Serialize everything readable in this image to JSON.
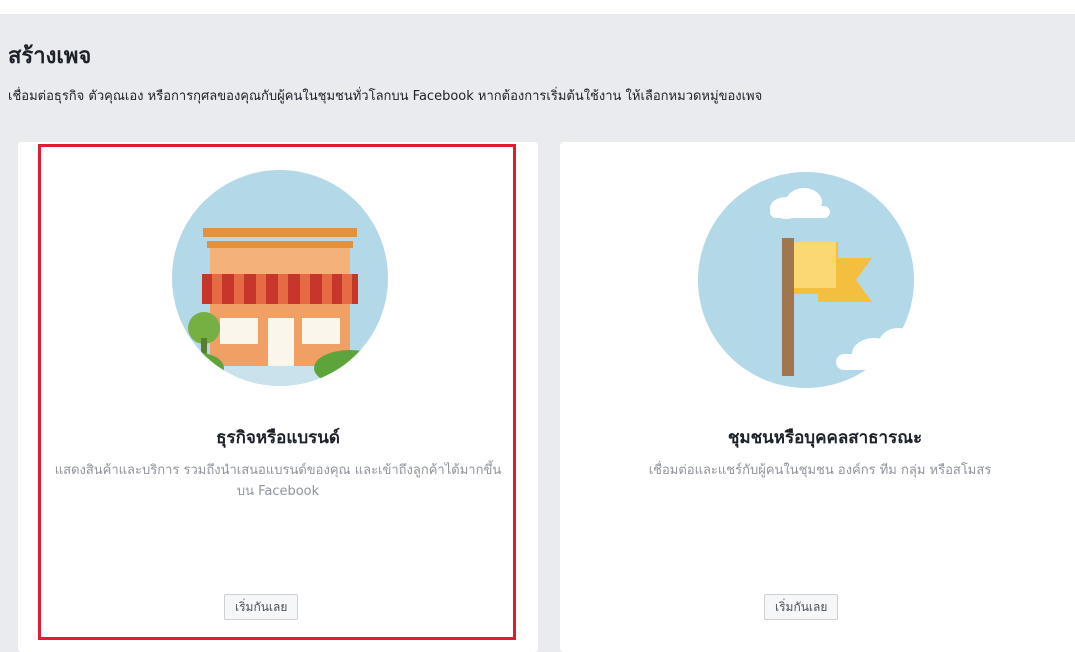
{
  "header": {
    "title": "สร้างเพจ",
    "subtitle": "เชื่อมต่อธุรกิจ ตัวคุณเอง หรือการกุศลของคุณกับผู้คนในชุมชนทั่วโลกบน Facebook หากต้องการเริ่มต้นใช้งาน ให้เลือกหมวดหมู่ของเพจ"
  },
  "cards": [
    {
      "title": "ธุรกิจหรือแบรนด์",
      "description": "แสดงสินค้าและบริการ รวมถึงนำเสนอแบรนด์ของคุณ และเข้าถึงลูกค้าได้มากขึ้นบน Facebook",
      "button_label": "เริ่มกันเลย",
      "icon": "storefront-icon",
      "highlighted": true
    },
    {
      "title": "ชุมชนหรือบุคคลสาธารณะ",
      "description": "เชื่อมต่อและแชร์กับผู้คนในชุมชน องค์กร ทีม กลุ่ม หรือสโมสร",
      "button_label": "เริ่มกันเลย",
      "icon": "flag-icon",
      "highlighted": false
    }
  ],
  "colors": {
    "background": "#e9ebee",
    "card": "#ffffff",
    "highlight_border": "#e21b2f",
    "illustration_circle": "#b3d8e8",
    "muted_text": "#90949c"
  }
}
